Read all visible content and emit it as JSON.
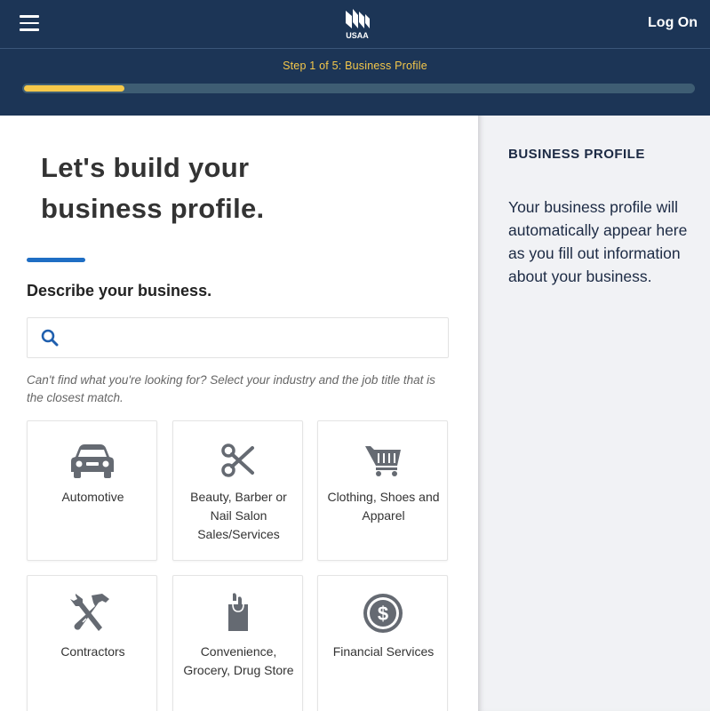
{
  "header": {
    "menu_icon": "hamburger-menu-icon",
    "logo_icon": "usaa-eagle-logo",
    "logo_text": "USAA",
    "log_on_label": "Log On"
  },
  "progress": {
    "step_label": "Step 1 of 5: Business Profile",
    "fraction": 0.15,
    "bar_color": "#f5c84a"
  },
  "main": {
    "headline": "Let's build your business profile.",
    "question_label": "Describe your business.",
    "search": {
      "icon": "search-icon",
      "value": "",
      "placeholder": ""
    },
    "hint_text": "Can't find what you're looking for? Select your industry and the job title that is the closest match.",
    "industries": [
      {
        "label": "Automotive",
        "icon": "car-icon"
      },
      {
        "label": "Beauty, Barber or Nail Salon Sales/Services",
        "icon": "scissors-icon"
      },
      {
        "label": "Clothing, Shoes and Apparel",
        "icon": "shopping-cart-icon"
      },
      {
        "label": "Contractors",
        "icon": "tools-icon"
      },
      {
        "label": "Convenience, Grocery, Drug Store",
        "icon": "grocery-bag-icon"
      },
      {
        "label": "Financial Services",
        "icon": "dollar-coin-icon"
      }
    ]
  },
  "sidebar": {
    "title": "BUSINESS PROFILE",
    "body": "Your business profile will automatically appear here as you fill out information about your business."
  },
  "colors": {
    "header_bg": "#1c3556",
    "accent_blue": "#1f6ec4",
    "progress_yellow": "#f5c84a",
    "panel_bg": "#f1f2f5"
  }
}
